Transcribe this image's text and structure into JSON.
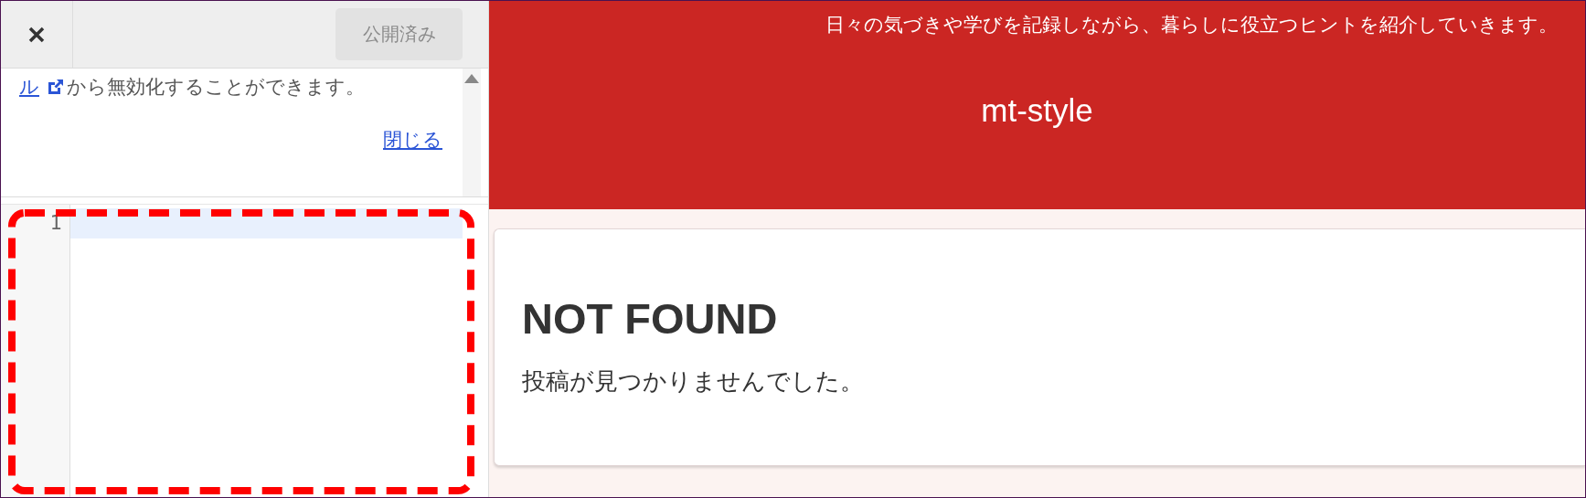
{
  "panel": {
    "publish_button": {
      "label": "公開済み",
      "disabled": true
    },
    "notice": {
      "link": "ル",
      "text": "から無効化することができます。",
      "close_link": "閉じる"
    },
    "editor": {
      "line_numbers": [
        "1"
      ]
    }
  },
  "site": {
    "tagline": "日々の気づきや学びを記録しながら、暮らしに役立つヒントを紹介していきます。",
    "title": "mt-style"
  },
  "content": {
    "heading": "NOT FOUND",
    "message": "投稿が見つかりませんでした。"
  }
}
